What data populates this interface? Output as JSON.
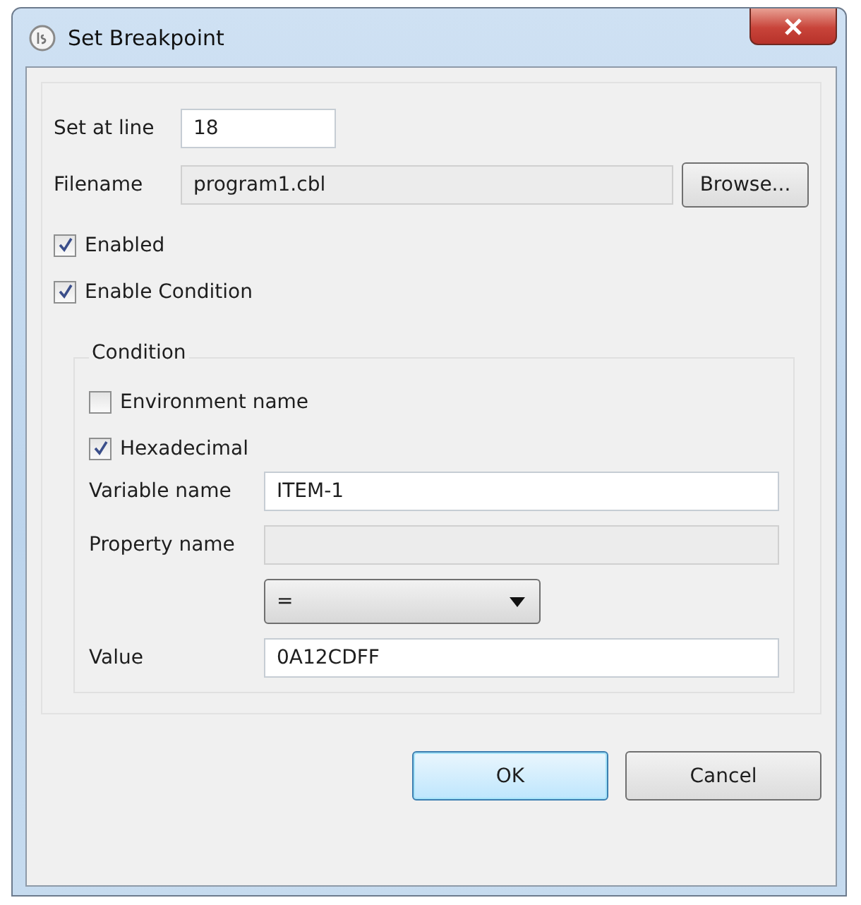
{
  "window": {
    "title": "Set Breakpoint"
  },
  "set_at_line": {
    "label": "Set at line",
    "value": "18",
    "disabled": false
  },
  "filename": {
    "label": "Filename",
    "value": "program1.cbl",
    "disabled": true,
    "button": "Browse..."
  },
  "options": [
    {
      "label": "Enabled",
      "checked": true
    },
    {
      "label": "Enable Condition",
      "checked": true
    }
  ],
  "condition": {
    "title": "Condition",
    "options": [
      {
        "label": "Environment name",
        "checked": false
      },
      {
        "label": "Hexadecimal",
        "checked": true
      }
    ],
    "fields": [
      {
        "kind": "text",
        "label": "Variable name",
        "value": "ITEM-1",
        "disabled": false
      },
      {
        "kind": "text",
        "label": "Property name",
        "disabled": true
      },
      {
        "kind": "select",
        "value": "="
      },
      {
        "kind": "text",
        "label": "Value",
        "value": "0A12CDFF",
        "disabled": false
      }
    ]
  },
  "buttons": [
    {
      "label": "OK",
      "default": true
    },
    {
      "label": "Cancel",
      "default": false
    }
  ]
}
